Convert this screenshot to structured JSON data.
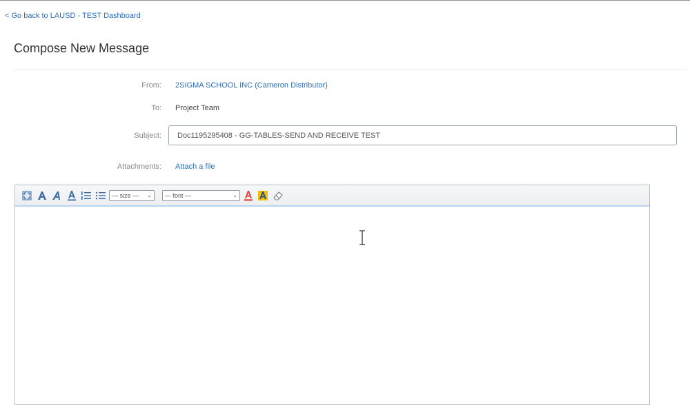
{
  "nav": {
    "back_link": "< Go back to LAUSD - TEST Dashboard"
  },
  "page": {
    "title": "Compose New Message"
  },
  "form": {
    "from_label": "From:",
    "from_value": "2SIGMA SCHOOL INC  (Cameron Distributor)",
    "to_label": "To:",
    "to_value": "Project Team",
    "subject_label": "Subject:",
    "subject_value": "Doc1195295408 - GG-TABLES-SEND AND RECEIVE TEST",
    "attachments_label": "Attachments:",
    "attach_link": "Attach a file"
  },
  "toolbar": {
    "size_select": "— size —",
    "font_select": "— font —",
    "icons": [
      "fullscreen-icon",
      "bold-icon",
      "italic-icon",
      "underline-icon",
      "numbered-list-icon",
      "bulleted-list-icon",
      "font-color-icon",
      "highlight-color-icon",
      "eraser-icon"
    ]
  },
  "colors": {
    "link": "#2a6ebb",
    "toolbar_icon": "#3a6ea5",
    "font_color_icon": "#e0413a",
    "highlight_icon": "#f2c200"
  }
}
